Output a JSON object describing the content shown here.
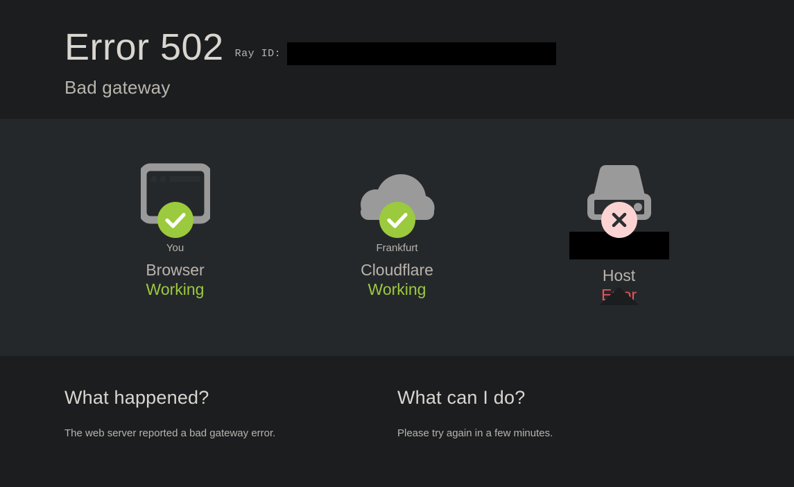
{
  "header": {
    "error_code": "Error 502",
    "error_description": "Bad gateway",
    "rayid_label": "Ray ID:",
    "rayid_value": ""
  },
  "status": {
    "columns": [
      {
        "icon": "browser-icon",
        "badge": "check-badge-icon",
        "location": "You",
        "location_redacted": false,
        "name": "Browser",
        "status": "Working",
        "state": "ok"
      },
      {
        "icon": "cloud-icon",
        "badge": "check-badge-icon",
        "location": "Frankfurt",
        "location_redacted": false,
        "name": "Cloudflare",
        "status": "Working",
        "state": "ok"
      },
      {
        "icon": "server-icon",
        "badge": "error-badge-icon",
        "location": "",
        "location_redacted": true,
        "name": "Host",
        "status": "Error",
        "state": "error"
      }
    ]
  },
  "explanations": [
    {
      "title": "What happened?",
      "body": "The web server reported a bad gateway error."
    },
    {
      "title": "What can I do?",
      "body": "Please try again in a few minutes."
    }
  ],
  "colors": {
    "band_dark": "#1b1d1f",
    "band_light": "#25282b",
    "text_primary": "#d9d5cf",
    "text_secondary": "#b9b4ad",
    "icon_gray": "#9a9a9a",
    "status_ok": "#9bca3e",
    "status_error": "#e9555a",
    "badge_error_bg": "#fbd3d3",
    "redaction": "#000000"
  }
}
